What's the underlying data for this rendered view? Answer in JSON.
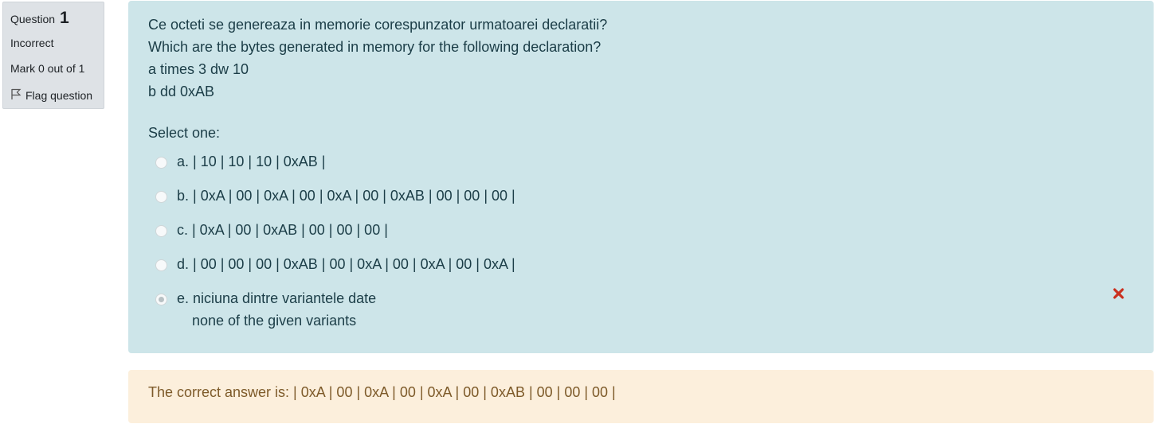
{
  "info": {
    "question_label": "Question",
    "question_number": "1",
    "state": "Incorrect",
    "grade": "Mark 0 out of 1",
    "flag_label": "Flag question"
  },
  "question": {
    "lines": [
      "Ce octeti se genereaza in memorie corespunzator urmatoarei declaratii?",
      "Which are the bytes generated in memory for the following declaration?",
      "a times 3 dw 10",
      "b dd 0xAB"
    ],
    "prompt": "Select one:",
    "options": [
      {
        "text": "a. | 10 | 10 | 10 | 0xAB |",
        "selected": false
      },
      {
        "text": "b. | 0xA | 00 | 0xA | 00 | 0xA | 00 | 0xAB | 00 | 00 | 00 |",
        "selected": false
      },
      {
        "text": "c. | 0xA | 00 | 0xAB | 00 | 00 | 00 |",
        "selected": false
      },
      {
        "text": "d. | 00 | 00 | 00 | 0xAB | 00 | 0xA | 00 | 0xA | 00 | 0xA |",
        "selected": false
      },
      {
        "text": "e. niciuna dintre variantele date",
        "text2": "none of the given variants",
        "selected": true
      }
    ],
    "result_icon": "incorrect-x-icon"
  },
  "feedback": {
    "text": "The correct answer is: | 0xA | 00 | 0xA | 00 | 0xA | 00 | 0xAB | 00 | 00 | 00 |"
  },
  "colors": {
    "formulation_bg": "#cde5e9",
    "feedback_bg": "#fcefdc",
    "incorrect_icon": "#ca3120"
  }
}
